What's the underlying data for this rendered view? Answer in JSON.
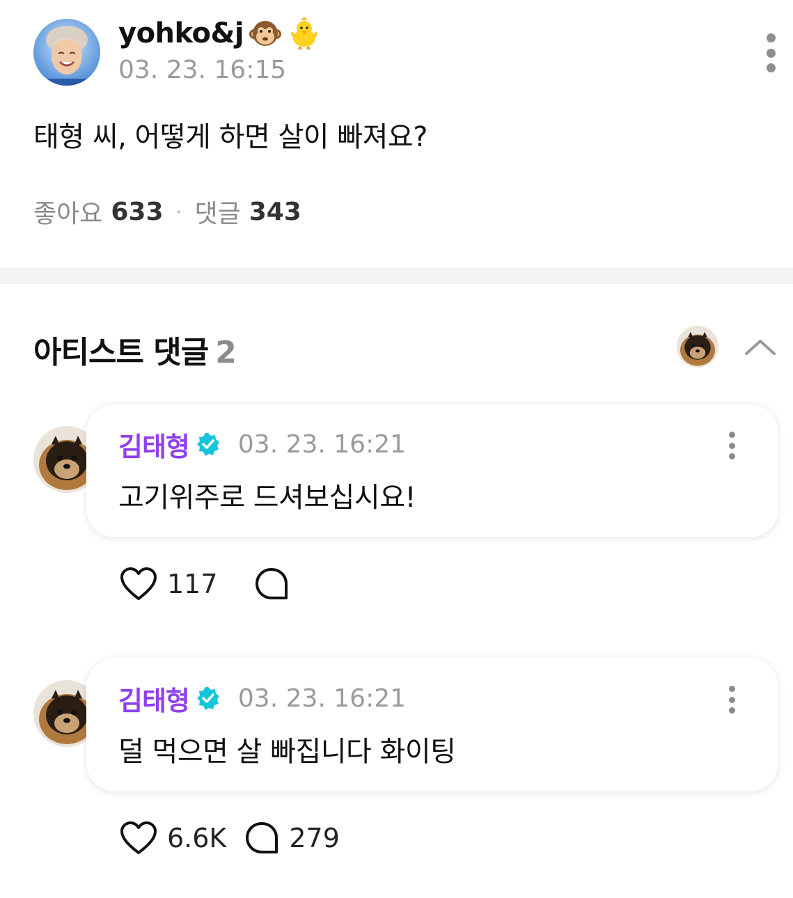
{
  "post": {
    "author": "yohko&j",
    "author_emojis": [
      "monkey-face-icon",
      "baby-chick-icon"
    ],
    "date": "03. 23. 16:15",
    "body": "태형 씨, 어떻게 하면 살이 빠져요?",
    "likes_label": "좋아요",
    "likes_count": "633",
    "separator": "·",
    "comments_label": "댓글",
    "comments_count": "343"
  },
  "artist_comments": {
    "title": "아티스트 댓글",
    "count": "2",
    "items": [
      {
        "name": "김태형",
        "verified": true,
        "date": "03. 23. 16:21",
        "text": "고기위주로 드셔보십시요!",
        "likes": "117",
        "replies": ""
      },
      {
        "name": "김태형",
        "verified": true,
        "date": "03. 23. 16:21",
        "text": "덜 먹으면 살 빠집니다 화이팅",
        "likes": "6.6K",
        "replies": "279"
      }
    ]
  },
  "colors": {
    "artist_name": "#8f3ff0",
    "verified_badge": "#16c5d9",
    "muted_text": "#9a9a9a",
    "divider": "#f3f3f3"
  }
}
